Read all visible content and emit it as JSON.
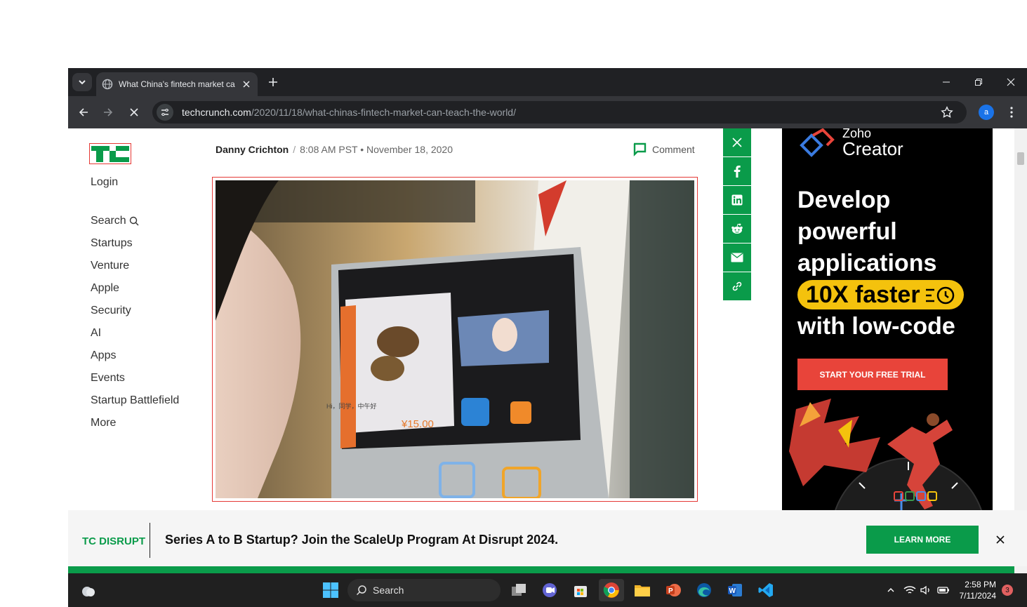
{
  "browser": {
    "tab": {
      "title": "What China's fintech market ca",
      "favicon": "globe-icon"
    },
    "address": {
      "host": "techcrunch.com",
      "path": "/2020/11/18/what-chinas-fintech-market-can-teach-the-world/"
    },
    "profile_initial": "a"
  },
  "site": {
    "login": "Login",
    "nav": [
      "Search",
      "Startups",
      "Venture",
      "Apple",
      "Security",
      "AI",
      "Apps",
      "Events",
      "Startup Battlefield",
      "More"
    ]
  },
  "article": {
    "author": "Danny Crichton",
    "separator": "/",
    "timestamp": "8:08 AM PST • November 18, 2020",
    "comment_label": "Comment",
    "hero_image": {
      "screen_text_1": "Hi，同学，中午好",
      "screen_price": "¥15.00"
    }
  },
  "share": [
    "x-icon",
    "facebook-icon",
    "linkedin-icon",
    "reddit-icon",
    "email-icon",
    "link-icon"
  ],
  "ad": {
    "brand_small": "Zoho",
    "brand_large": "Creator",
    "line1": "Develop",
    "line2": "powerful",
    "line3": "applications",
    "highlight": "10X faster",
    "line5": "with low-code",
    "cta": "START YOUR FREE TRIAL",
    "colors": {
      "background": "#000000",
      "highlight": "#f4c20d",
      "cta": "#e8443a"
    }
  },
  "banner": {
    "logo": "TC DISRUPT",
    "text": "Series A to B Startup? Join the ScaleUp Program At Disrupt 2024.",
    "button": "LEARN MORE"
  },
  "taskbar": {
    "search_label": "Search",
    "time": "2:58 PM",
    "date": "7/11/2024",
    "notifications": "3"
  },
  "colors": {
    "tc_green": "#0a9b4a",
    "chrome_dark": "#202124",
    "chrome_toolbar": "#35363a"
  }
}
